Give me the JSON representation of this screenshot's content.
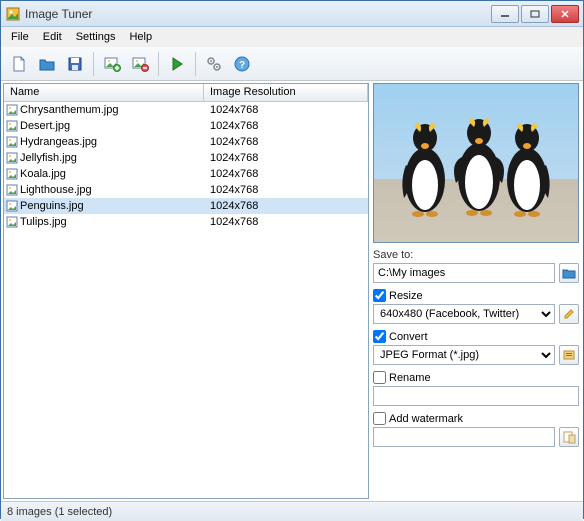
{
  "window": {
    "title": "Image Tuner"
  },
  "menu": {
    "file": "File",
    "edit": "Edit",
    "settings": "Settings",
    "help": "Help"
  },
  "listheader": {
    "name": "Name",
    "resolution": "Image Resolution"
  },
  "files": [
    {
      "name": "Chrysanthemum.jpg",
      "resolution": "1024x768",
      "selected": false
    },
    {
      "name": "Desert.jpg",
      "resolution": "1024x768",
      "selected": false
    },
    {
      "name": "Hydrangeas.jpg",
      "resolution": "1024x768",
      "selected": false
    },
    {
      "name": "Jellyfish.jpg",
      "resolution": "1024x768",
      "selected": false
    },
    {
      "name": "Koala.jpg",
      "resolution": "1024x768",
      "selected": false
    },
    {
      "name": "Lighthouse.jpg",
      "resolution": "1024x768",
      "selected": false
    },
    {
      "name": "Penguins.jpg",
      "resolution": "1024x768",
      "selected": true
    },
    {
      "name": "Tulips.jpg",
      "resolution": "1024x768",
      "selected": false
    }
  ],
  "panel": {
    "saveto_label": "Save to:",
    "saveto_value": "C:\\My images",
    "resize_label": "Resize",
    "resize_checked": true,
    "resize_value": "640x480 (Facebook, Twitter)",
    "convert_label": "Convert",
    "convert_checked": true,
    "convert_value": "JPEG Format (*.jpg)",
    "rename_label": "Rename",
    "rename_checked": false,
    "rename_value": "",
    "watermark_label": "Add watermark",
    "watermark_checked": false,
    "watermark_value": ""
  },
  "status": {
    "text": "8 images (1 selected)"
  }
}
